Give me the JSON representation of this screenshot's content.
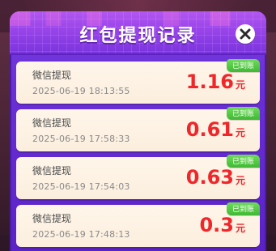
{
  "modal": {
    "title": "红包提现记录",
    "close_icon": "close-icon"
  },
  "records": [
    {
      "type": "微信提现",
      "time": "2025-06-19 18:13:55",
      "amount": "1.16",
      "unit": "元",
      "status": "已到账"
    },
    {
      "type": "微信提现",
      "time": "2025-06-19 17:58:33",
      "amount": "0.61",
      "unit": "元",
      "status": "已到账"
    },
    {
      "type": "微信提现",
      "time": "2025-06-19 17:54:03",
      "amount": "0.63",
      "unit": "元",
      "status": "已到账"
    },
    {
      "type": "微信提现",
      "time": "2025-06-19 17:48:13",
      "amount": "0.3",
      "unit": "元",
      "status": "已到账"
    }
  ],
  "colors": {
    "amount": "#f0262a",
    "badge": "#4fc23f",
    "header": "#9b45ea",
    "modal": "#6a2fd6"
  }
}
